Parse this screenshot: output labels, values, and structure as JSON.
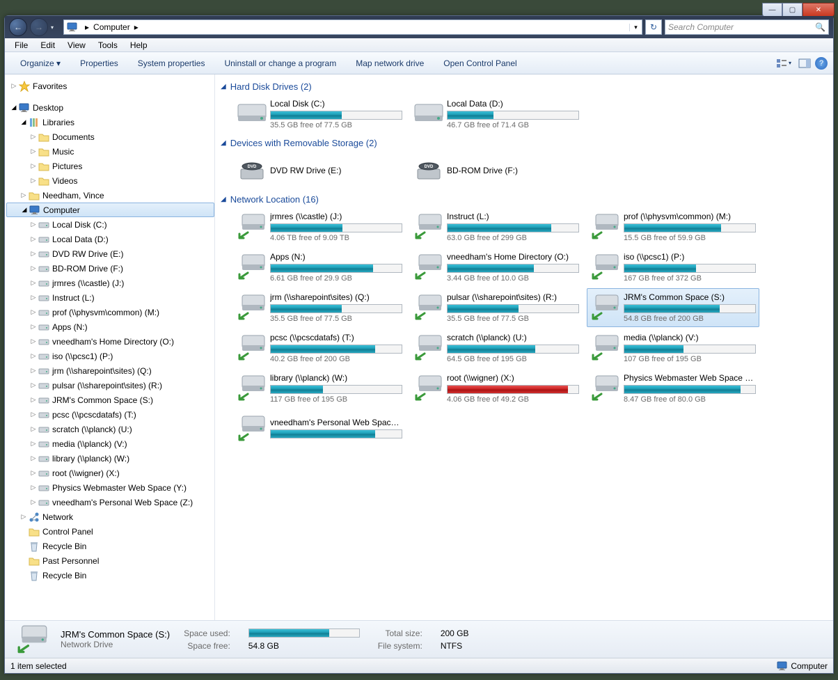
{
  "window_controls": {
    "min": "—",
    "max": "▢",
    "close": "✕"
  },
  "address": {
    "location": "Computer",
    "arrow": "▸",
    "dropdown": "▾",
    "history": "▾"
  },
  "search": {
    "placeholder": "Search Computer"
  },
  "menu": [
    "File",
    "Edit",
    "View",
    "Tools",
    "Help"
  ],
  "toolbar": {
    "organize": "Organize ▾",
    "items": [
      "Properties",
      "System properties",
      "Uninstall or change a program",
      "Map network drive",
      "Open Control Panel"
    ]
  },
  "sidebar": {
    "favorites": "Favorites",
    "desktop": "Desktop",
    "libraries": "Libraries",
    "lib_items": [
      "Documents",
      "Music",
      "Pictures",
      "Videos"
    ],
    "user": "Needham, Vince",
    "computer": "Computer",
    "drives": [
      "Local Disk (C:)",
      "Local Data (D:)",
      "DVD RW Drive (E:)",
      "BD-ROM Drive (F:)",
      "jrmres (\\\\castle) (J:)",
      "Instruct (L:)",
      "prof (\\\\physvm\\common) (M:)",
      "Apps (N:)",
      "vneedham's  Home Directory (O:)",
      "iso (\\\\pcsc1) (P:)",
      "jrm (\\\\sharepoint\\sites) (Q:)",
      "pulsar (\\\\sharepoint\\sites) (R:)",
      "JRM's Common Space (S:)",
      "pcsc (\\\\pcscdatafs) (T:)",
      "scratch (\\\\planck) (U:)",
      "media (\\\\planck) (V:)",
      "library (\\\\planck) (W:)",
      "root (\\\\wigner) (X:)",
      "Physics Webmaster Web Space (Y:)",
      "vneedham's  Personal Web Space (Z:)"
    ],
    "network": "Network",
    "control_panel": "Control Panel",
    "recycle1": "Recycle Bin",
    "past": "Past Personnel",
    "recycle2": "Recycle Bin"
  },
  "groups": {
    "hdd": "Hard Disk Drives (2)",
    "removable": "Devices with Removable Storage (2)",
    "network": "Network Location (16)"
  },
  "hdd": [
    {
      "name": "Local Disk (C:)",
      "stat": "35.5 GB free of 77.5 GB",
      "pct": 54
    },
    {
      "name": "Local Data (D:)",
      "stat": "46.7 GB free of 71.4 GB",
      "pct": 35
    }
  ],
  "removable": [
    {
      "name": "DVD RW Drive (E:)"
    },
    {
      "name": "BD-ROM Drive (F:)"
    }
  ],
  "net": [
    {
      "name": "jrmres (\\\\castle) (J:)",
      "stat": "4.06 TB free of 9.09 TB",
      "pct": 55
    },
    {
      "name": "Instruct (L:)",
      "stat": "63.0 GB free of 299 GB",
      "pct": 79
    },
    {
      "name": "prof (\\\\physvm\\common) (M:)",
      "stat": "15.5 GB free of 59.9 GB",
      "pct": 74
    },
    {
      "name": "Apps (N:)",
      "stat": "6.61 GB free of 29.9 GB",
      "pct": 78
    },
    {
      "name": "vneedham's  Home Directory (O:)",
      "stat": "3.44 GB free of 10.0 GB",
      "pct": 66
    },
    {
      "name": "iso (\\\\pcsc1) (P:)",
      "stat": "167 GB free of 372 GB",
      "pct": 55
    },
    {
      "name": "jrm (\\\\sharepoint\\sites) (Q:)",
      "stat": "35.5 GB free of 77.5 GB",
      "pct": 54
    },
    {
      "name": "pulsar (\\\\sharepoint\\sites) (R:)",
      "stat": "35.5 GB free of 77.5 GB",
      "pct": 54
    },
    {
      "name": "JRM's Common Space (S:)",
      "stat": "54.8 GB free of 200 GB",
      "pct": 73,
      "sel": true
    },
    {
      "name": "pcsc (\\\\pcscdatafs) (T:)",
      "stat": "40.2 GB free of 200 GB",
      "pct": 80
    },
    {
      "name": "scratch (\\\\planck) (U:)",
      "stat": "64.5 GB free of 195 GB",
      "pct": 67
    },
    {
      "name": "media (\\\\planck) (V:)",
      "stat": "107 GB free of 195 GB",
      "pct": 45
    },
    {
      "name": "library (\\\\planck) (W:)",
      "stat": "117 GB free of 195 GB",
      "pct": 40
    },
    {
      "name": "root (\\\\wigner) (X:)",
      "stat": "4.06 GB free of 49.2 GB",
      "pct": 92,
      "red": true
    },
    {
      "name": "Physics Webmaster Web Space (Y:)",
      "stat": "8.47 GB free of 80.0 GB",
      "pct": 89
    },
    {
      "name": "vneedham's  Personal Web Space (Z:)",
      "stat": "",
      "pct": 80
    }
  ],
  "details": {
    "title": "JRM's Common Space (S:)",
    "sub": "Network Drive",
    "space_used_label": "Space used:",
    "space_free_label": "Space free:",
    "space_free": "54.8 GB",
    "total_label": "Total size:",
    "total": "200 GB",
    "fs_label": "File system:",
    "fs": "NTFS",
    "bar_pct": 73
  },
  "status": {
    "left": "1 item selected",
    "right": "Computer"
  }
}
